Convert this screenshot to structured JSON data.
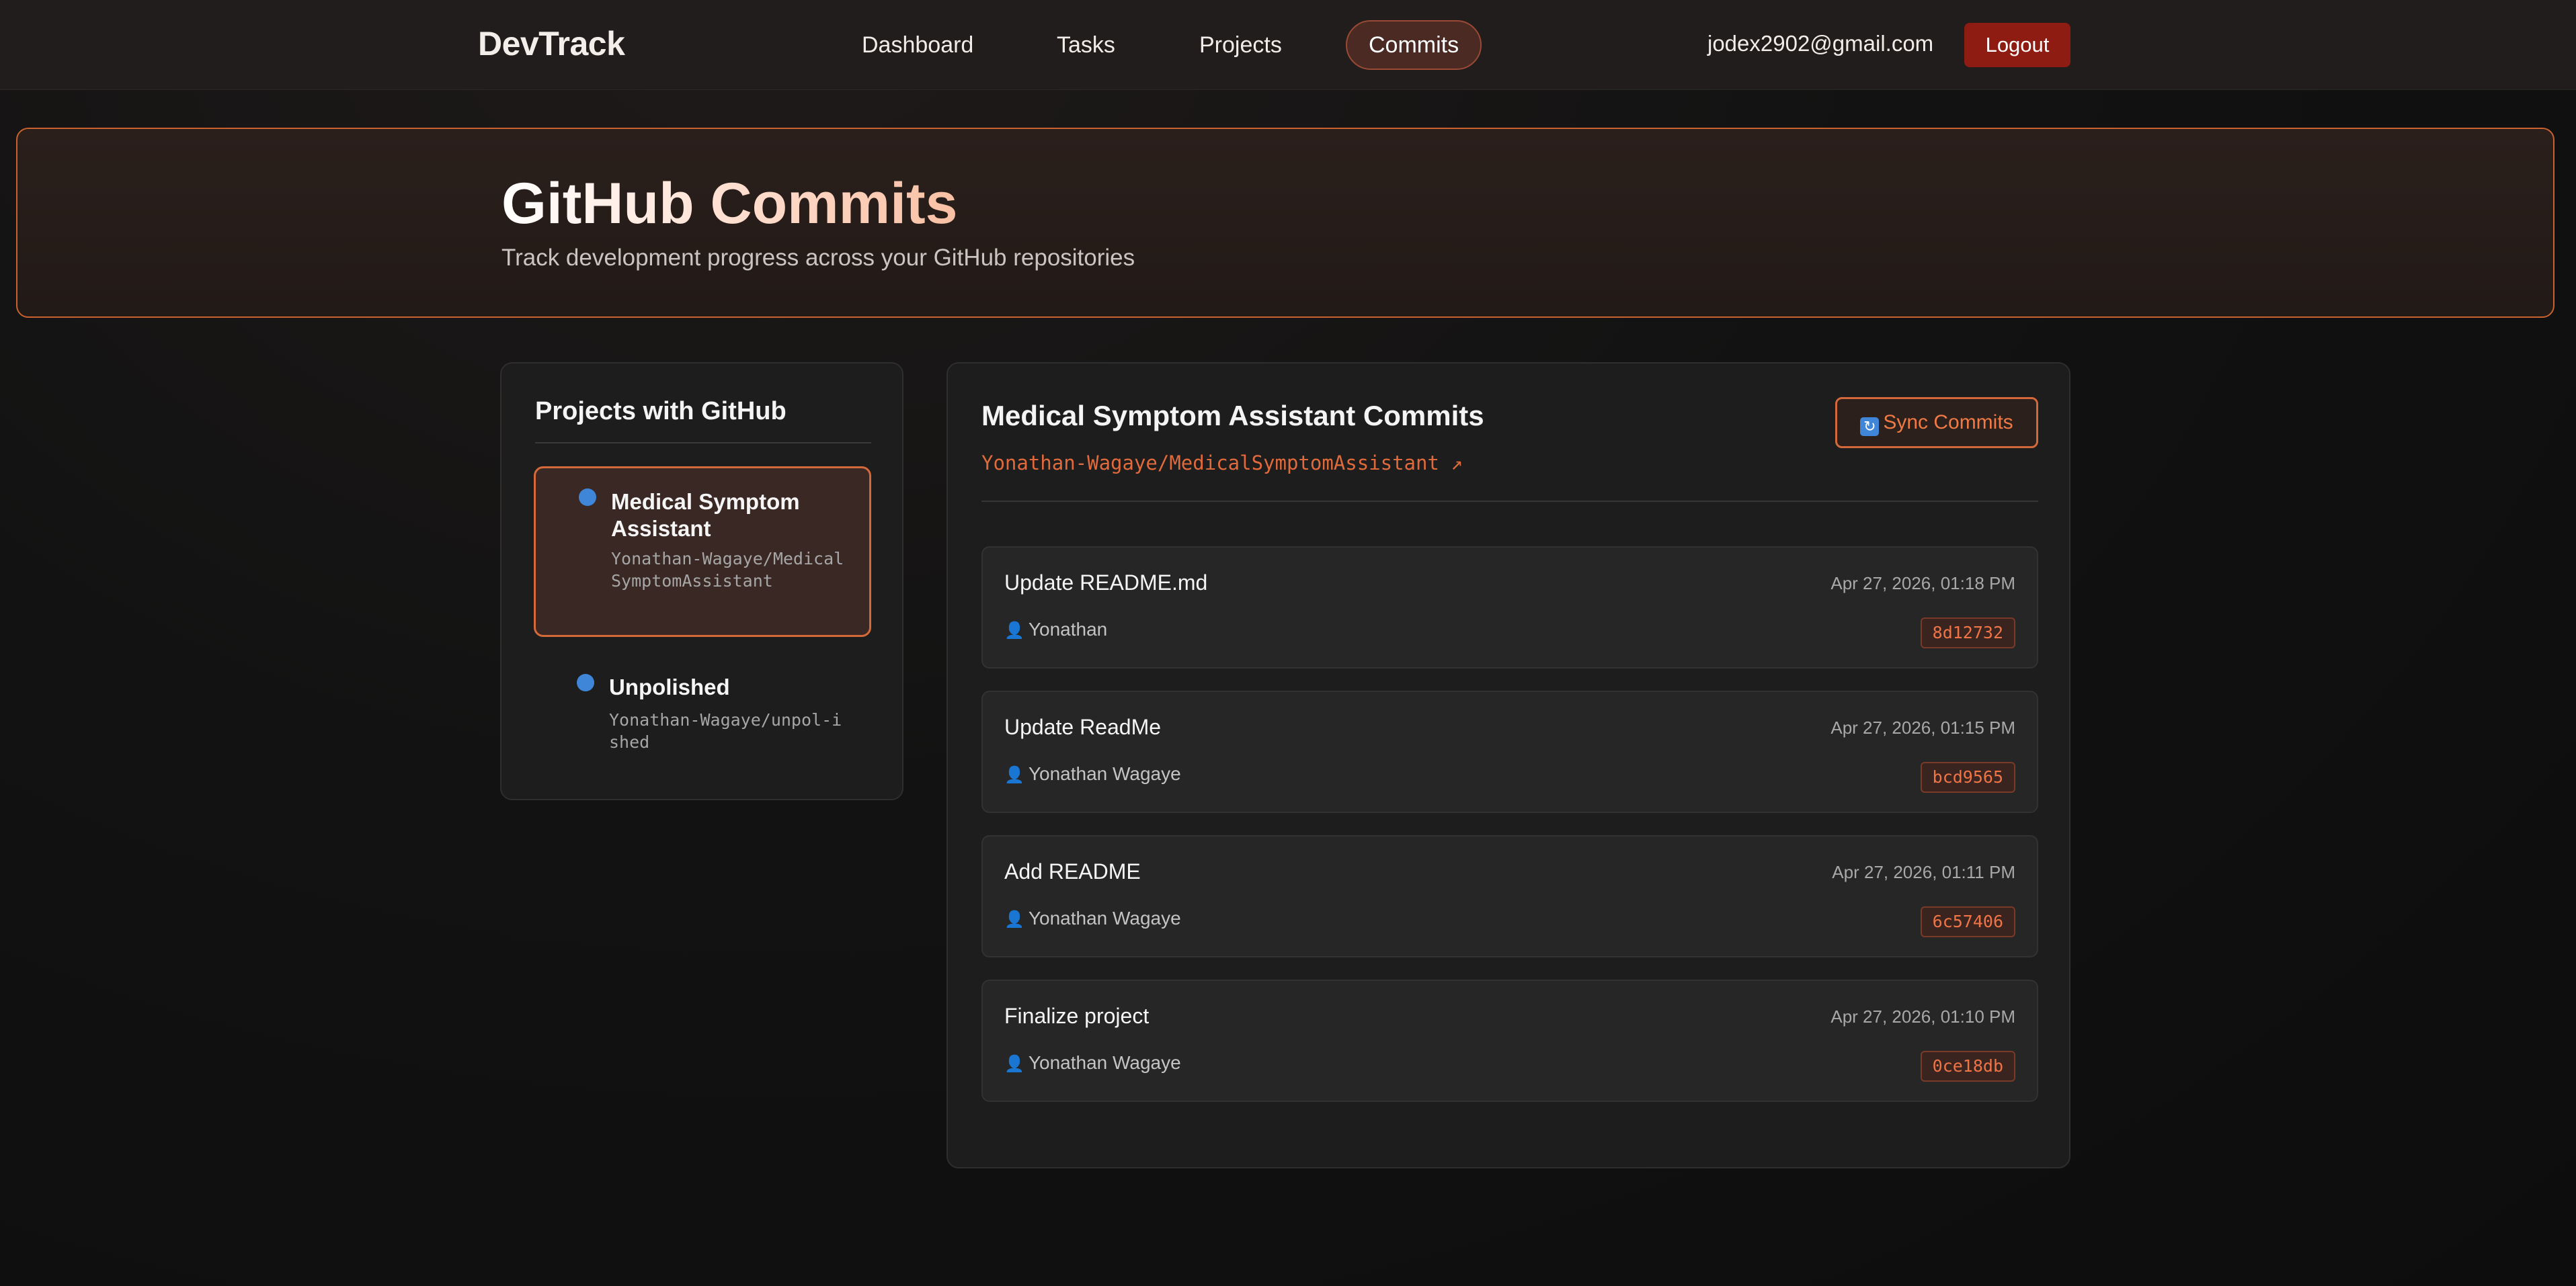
{
  "nav": {
    "brand": "DevTrack",
    "links": [
      "Dashboard",
      "Tasks",
      "Projects",
      "Commits"
    ],
    "active": "Commits",
    "user_email": "jodex2902@gmail.com",
    "logout_label": "Logout"
  },
  "hero": {
    "title": "GitHub Commits",
    "subtitle": "Track development progress across your GitHub repositories"
  },
  "sidebar": {
    "title": "Projects with GitHub",
    "projects": [
      {
        "name": "Medical Symptom Assistant",
        "repo": "Yonathan-Wagaye/MedicalSymptomAssistant",
        "selected": true
      },
      {
        "name": "Unpolished",
        "repo": "Yonathan-Wagaye/unpol-ished",
        "selected": false
      }
    ]
  },
  "commits_panel": {
    "title": "Medical Symptom Assistant Commits",
    "repo_link": "Yonathan-Wagaye/MedicalSymptomAssistant ↗",
    "sync_label": "Sync Commits",
    "commits": [
      {
        "message": "Update README.md",
        "date": "Apr 27, 2026, 01:18 PM",
        "author": "Yonathan",
        "sha": "8d12732"
      },
      {
        "message": "Update ReadMe",
        "date": "Apr 27, 2026, 01:15 PM",
        "author": "Yonathan Wagaye",
        "sha": "bcd9565"
      },
      {
        "message": "Add README",
        "date": "Apr 27, 2026, 01:11 PM",
        "author": "Yonathan Wagaye",
        "sha": "6c57406"
      },
      {
        "message": "Finalize project",
        "date": "Apr 27, 2026, 01:10 PM",
        "author": "Yonathan Wagaye",
        "sha": "0ce18db"
      }
    ]
  },
  "icons": {
    "sync": "sync-icon",
    "author": "person-icon",
    "project_dot": "status-dot-icon"
  },
  "colors": {
    "accent": "#e06a3c",
    "logout": "#8e1c12",
    "project_dot": "#3f86d8"
  }
}
